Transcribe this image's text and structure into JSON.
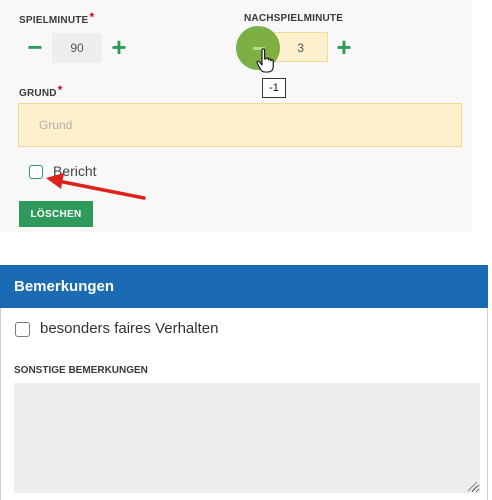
{
  "spiel": {
    "spielminute_label": "SPIELMINUTE",
    "required_marker": "*",
    "spielminute_value": "90",
    "nachspiel_label": "NACHSPIELMINUTE",
    "nachspiel_value": "3",
    "tooltip": "-1",
    "minus_glyph": "−",
    "plus_glyph": "+"
  },
  "grund": {
    "label": "GRUND",
    "placeholder": "Grund"
  },
  "bericht": {
    "label": "Bericht"
  },
  "loeschen": {
    "label": "LÖSCHEN"
  },
  "bemerkungen": {
    "title": "Bemerkungen",
    "fair_label": "besonders faires Verhalten",
    "sonstige_label": "SONSTIGE BEMERKUNGEN"
  },
  "colors": {
    "green": "#2e9a5c",
    "input_yellow": "#fdf0cc",
    "header_blue": "#1a6ab4",
    "required_red": "#d0021b",
    "annotation_arrow": "#e0201a"
  },
  "icons": [
    "minus-icon",
    "plus-icon",
    "hand-cursor-icon",
    "red-arrow-icon",
    "resize-grip-icon"
  ]
}
